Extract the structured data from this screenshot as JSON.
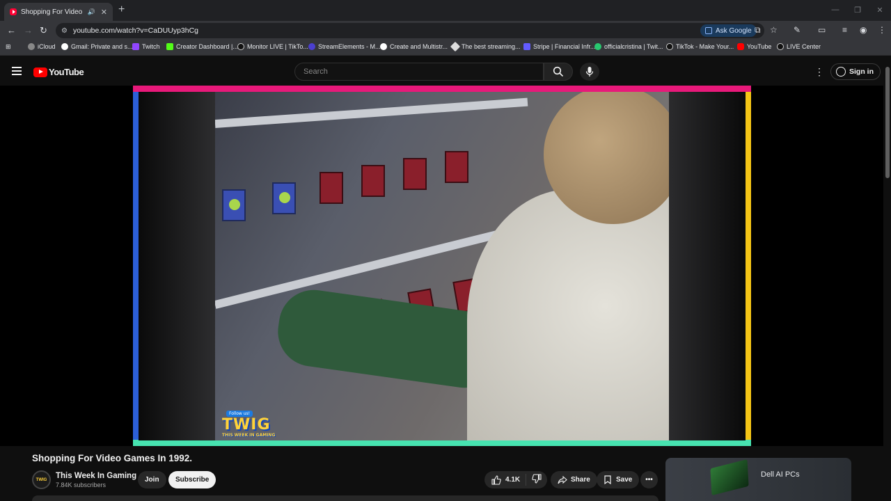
{
  "browser": {
    "tab_title": "Shopping For Video Games In 1992.",
    "url": "youtube.com/watch?v=CaDUUyp3hCg",
    "ask_google": "Ask Google",
    "bookmarks": [
      "iCloud",
      "Gmail: Private and s...",
      "Twitch",
      "Creator Dashboard |...",
      "Monitor LIVE | TikTo...",
      "StreamElements - M...",
      "Create and Multistr...",
      "The best streaming...",
      "Stripe | Financial Infr...",
      "officialcristina | Twit...",
      "TikTok - Make Your...",
      "YouTube",
      "LIVE Center"
    ]
  },
  "youtube": {
    "logo_text": "YouTube",
    "search_placeholder": "Search",
    "sign_in": "Sign in"
  },
  "video": {
    "title": "Shopping For Video Games In 1992.",
    "overlay": {
      "follow": "Follow us!",
      "logo": "TWIG",
      "sub": "THIS WEEK IN GAMING"
    }
  },
  "channel": {
    "name": "This Week In Gaming",
    "subscribers": "7.84K subscribers",
    "logo_text": "TWIG",
    "join": "Join",
    "subscribe": "Subscribe"
  },
  "actions": {
    "likes": "4.1K",
    "share": "Share",
    "save": "Save"
  },
  "ad": {
    "text": "Dell AI PCs"
  },
  "colors": {
    "brand_red": "#ff0000",
    "border_pink": "#e8197a",
    "border_blue": "#2c5fd8",
    "border_yellow": "#f4c516",
    "border_green": "#47e3b0"
  }
}
